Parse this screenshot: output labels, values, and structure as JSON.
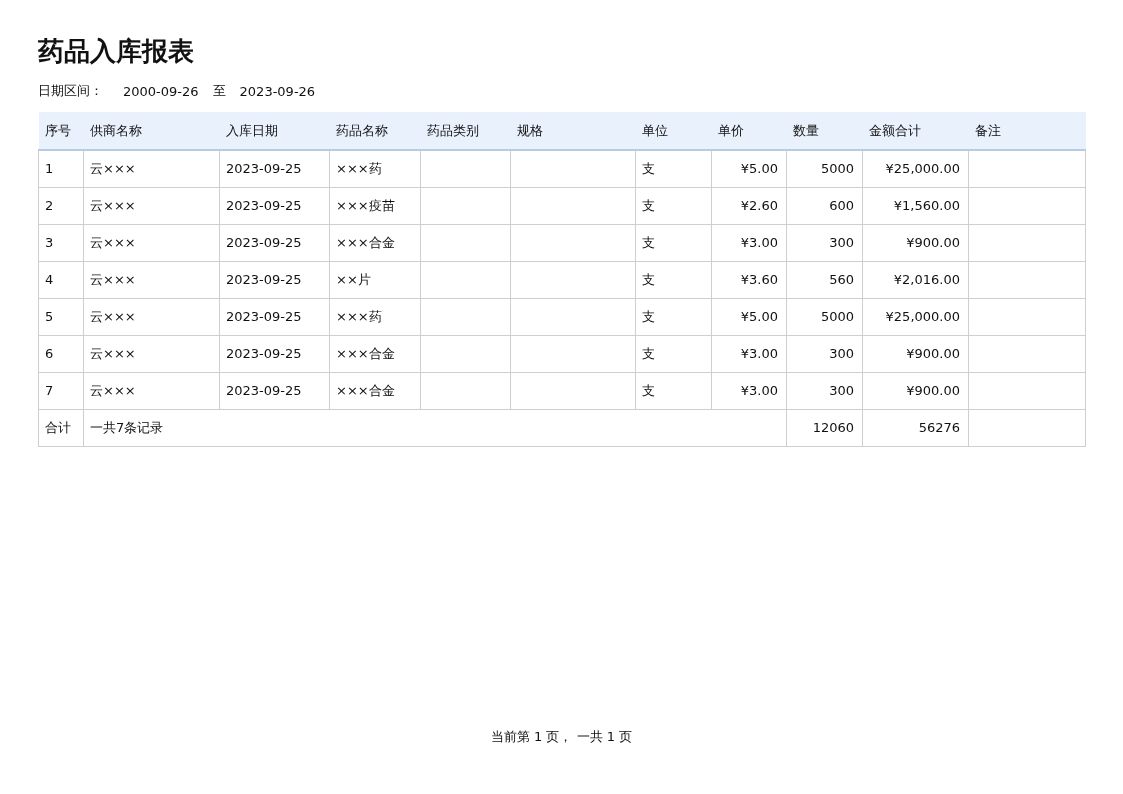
{
  "title": "药品入库报表",
  "date_range": {
    "label": "日期区间：",
    "start": "2000-09-26",
    "separator": "至",
    "end": "2023-09-26"
  },
  "table": {
    "columns": [
      "序号",
      "供商名称",
      "入库日期",
      "药品名称",
      "药品类别",
      "规格",
      "单位",
      "单价",
      "数量",
      "金额合计",
      "备注"
    ],
    "rows": [
      {
        "no": "1",
        "supplier": "云×××",
        "date": "2023-09-25",
        "drug": "×××药",
        "unit": "支",
        "price": "¥5.00",
        "qty": "5000",
        "amount": "¥25,000.00"
      },
      {
        "no": "2",
        "supplier": "云×××",
        "date": "2023-09-25",
        "drug": "×××疫苗",
        "unit": "支",
        "price": "¥2.60",
        "qty": "600",
        "amount": "¥1,560.00"
      },
      {
        "no": "3",
        "supplier": "云×××",
        "date": "2023-09-25",
        "drug": "×××合金",
        "unit": "支",
        "price": "¥3.00",
        "qty": "300",
        "amount": "¥900.00"
      },
      {
        "no": "4",
        "supplier": "云×××",
        "date": "2023-09-25",
        "drug": "××片",
        "unit": "支",
        "price": "¥3.60",
        "qty": "560",
        "amount": "¥2,016.00"
      },
      {
        "no": "5",
        "supplier": "云×××",
        "date": "2023-09-25",
        "drug": "×××药",
        "unit": "支",
        "price": "¥5.00",
        "qty": "5000",
        "amount": "¥25,000.00"
      },
      {
        "no": "6",
        "supplier": "云×××",
        "date": "2023-09-25",
        "drug": "×××合金",
        "unit": "支",
        "price": "¥3.00",
        "qty": "300",
        "amount": "¥900.00"
      },
      {
        "no": "7",
        "supplier": "云×××",
        "date": "2023-09-25",
        "drug": "×××合金",
        "unit": "支",
        "price": "¥3.00",
        "qty": "300",
        "amount": "¥900.00"
      }
    ],
    "summary": {
      "label": "合计",
      "text": "一共7条记录",
      "qty": "12060",
      "amount": "56276"
    }
  },
  "pagination": "当前第 1 页， 一共 1 页"
}
